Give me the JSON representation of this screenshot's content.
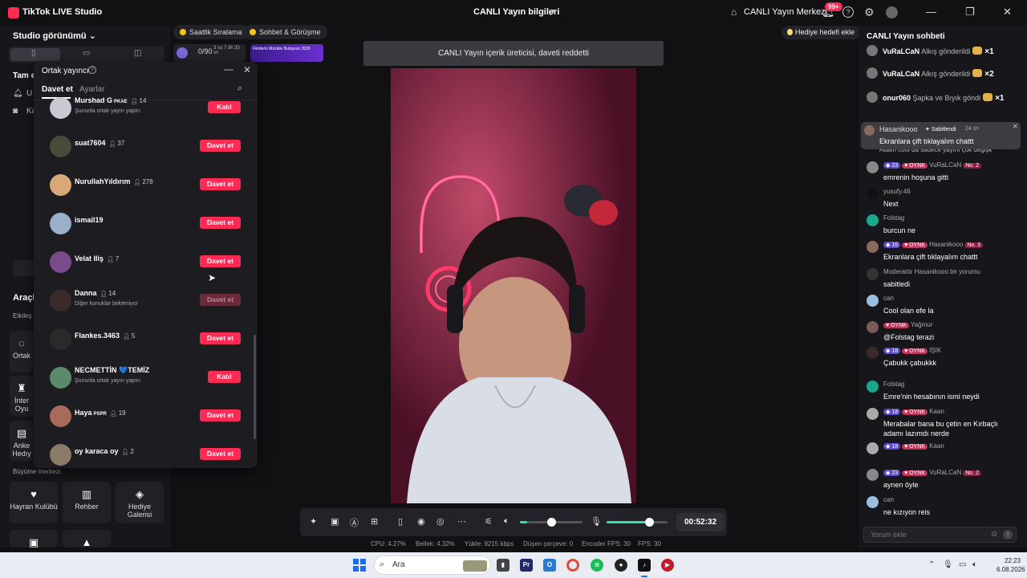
{
  "titlebar": {
    "app_title": "TikTok LIVE Studio",
    "center_title": "CANLI Yayın bilgileri",
    "live_center": "CANLI Yayın Merkezi",
    "notif_badge": "99+"
  },
  "left": {
    "studio_view": "Studio görünümü",
    "section_full": "Tam e",
    "item1": "U",
    "item2": "Ka",
    "tools_title": "Araçl",
    "engagement": "Etkileş",
    "tool_cohost": "Ortak",
    "tool_interactive": "İnter Oyu",
    "tool_anchor": "Anke Hedıy",
    "growth_center": "Büyüme merkezi",
    "fan_club": "Hayran Kulübü",
    "guide": "Rehber",
    "gift_gallery": "Hediye Galerisi"
  },
  "top_pills": {
    "hourly": "Saatlik Sıralama",
    "chat_meet": "Sohbet & Görüşme",
    "goal_value": "0/90",
    "goal_time": "3 sa 7 dk 33 sn",
    "banner_text": "Fikirlerin Müzikle Buluşsun 2026",
    "gift_goal": "Hediye hedefi ekle"
  },
  "cohost": {
    "title": "Ortak yayıncı",
    "tab_invite": "Davet et",
    "tab_settings": "Ayarlar",
    "rows": [
      {
        "name": "Murshad G",
        "badge": "PKAE",
        "count": "14",
        "sub": "Şununla ortak yayın yapın:",
        "button": "Katıl",
        "kind": "join",
        "color": "#c9c9d4"
      },
      {
        "name": "suat7604",
        "badge": "",
        "count": "37",
        "sub": "",
        "button": "Davet et",
        "kind": "invite",
        "color": "#4a4a3a"
      },
      {
        "name": "NurullahYıldırım",
        "badge": "",
        "count": "278",
        "sub": "",
        "button": "Davet et",
        "kind": "invite",
        "color": "#d8a878"
      },
      {
        "name": "ismail19",
        "badge": "",
        "count": "",
        "sub": "",
        "button": "Davet et",
        "kind": "invite",
        "color": "#9ab0c8"
      },
      {
        "name": "Velat Iliş",
        "badge": "",
        "count": "7",
        "sub": "",
        "button": "Davet et",
        "kind": "invite",
        "color": "#7a4a8a"
      },
      {
        "name": "Danna",
        "badge": "",
        "count": "14",
        "sub": "Diğer konuklar bekleniyor",
        "button": "Davet et",
        "kind": "disabled",
        "color": "#3a2a2a"
      },
      {
        "name": "Flankes.3463",
        "badge": "",
        "count": "5",
        "sub": "",
        "button": "Davet et",
        "kind": "invite",
        "color": "#2a2a2a"
      },
      {
        "name": "NECMETTİN 💙TEMİZ",
        "badge": "",
        "count": "",
        "sub": "Şununla ortak yayın yapın:",
        "button": "Katıl",
        "kind": "join",
        "color": "#5a8a6a"
      },
      {
        "name": "Haya",
        "badge": "PSPR",
        "count": "19",
        "sub": "",
        "button": "Davet et",
        "kind": "invite",
        "color": "#a86a5a"
      },
      {
        "name": "oy karaca oy",
        "badge": "",
        "count": "2",
        "sub": "",
        "button": "Davet et",
        "kind": "invite",
        "color": "#8a7a6a"
      }
    ]
  },
  "notice": "CANLI Yayın içerik üreticisi, daveti reddetti",
  "timer": "00:52:32",
  "stats": {
    "cpu": "CPU: 4.27%",
    "memory": "Bellek: 4.32%",
    "upload": "Yükle: 9215 kbps",
    "dropped": "Düşen çerçeve: 0",
    "encoder_fps": "Encoder FPS: 30",
    "fps": "FPS: 30"
  },
  "controls": {
    "volume_level": 0.5,
    "mic_level": 0.7
  },
  "chat": {
    "title": "CANLI Yayın sohbeti",
    "gifts": [
      {
        "user": "VuRaLCaN",
        "text": "Alkış gönderildi",
        "mult": "×1"
      },
      {
        "user": "VuRaLCaN",
        "text": "Alkış gönderildi",
        "mult": "×2"
      },
      {
        "user": "onur060",
        "text": "Şapka ve Bıyık göndi",
        "mult": "×1"
      }
    ],
    "pinned": {
      "user": "Hasanikooo",
      "badge": "Sabitlendi",
      "time": "24 sn",
      "text": "Ekranlara çift tıklayalım chattt"
    },
    "hidden_line": "Adam cool da sadece yayını çok değişk",
    "messages": [
      {
        "level": "23",
        "tag": "OYNK",
        "user": "VuRaLCaN",
        "no": "No. 2",
        "text": "emrenin hoşuna gitti",
        "color": "#888"
      },
      {
        "level": "",
        "tag": "",
        "user": "yusufy.46",
        "no": "",
        "text": "Next",
        "color": "#111"
      },
      {
        "level": "",
        "tag": "",
        "user": "Folstag",
        "no": "",
        "text": "burcun ne",
        "color": "#1aa88a"
      },
      {
        "level": "16",
        "tag": "OYNK",
        "user": "Hasanikooo",
        "no": "No. 3",
        "text": "Ekranlara çift tıklayalım chattt",
        "color": "#8a6a5a"
      },
      {
        "level": "",
        "tag": "",
        "user": "Moderatör Hasanikooo bir yorumu",
        "no": "",
        "text": "sabitledi",
        "color": "#333"
      },
      {
        "level": "",
        "tag": "",
        "user": "can",
        "no": "",
        "text": "Cool olan efe la",
        "color": "#9ac0e0"
      },
      {
        "level": "",
        "tag": "OYNK",
        "user": "Yağmur",
        "no": "",
        "text": "@Folstag terazi",
        "color": "#7a5a5a"
      },
      {
        "level": "18",
        "tag": "OYNK",
        "user": "IŞIK",
        "no": "",
        "text": "Çabukk çabukkk",
        "color": "#3a2a2a"
      },
      {
        "level": "",
        "tag": "",
        "user": "Folstag",
        "no": "",
        "text": "Emre'nin hesabının ismi neydi",
        "color": "#1aa88a"
      },
      {
        "level": "18",
        "tag": "OYNK",
        "user": "Kaan",
        "no": "",
        "text": "Merabalar bana bu çetin en Kırbaçlı",
        "text2": "adamı lazımdı nerde",
        "color": "#aaa"
      },
      {
        "level": "18",
        "tag": "OYNK",
        "user": "Kaan",
        "no": "",
        "text": "",
        "color": "#aaa"
      },
      {
        "level": "23",
        "tag": "OYNK",
        "user": "VuRaLCaN",
        "no": "No. 2",
        "text": "aynen öyle",
        "color": "#888"
      },
      {
        "level": "",
        "tag": "",
        "user": "can",
        "no": "",
        "text": "ne kızıyon reis",
        "color": "#9ac0e0"
      }
    ],
    "comment_placeholder": "Yorum ekle"
  },
  "taskbar": {
    "search": "Ara",
    "time": "22:23",
    "date": "6.08.2026"
  }
}
